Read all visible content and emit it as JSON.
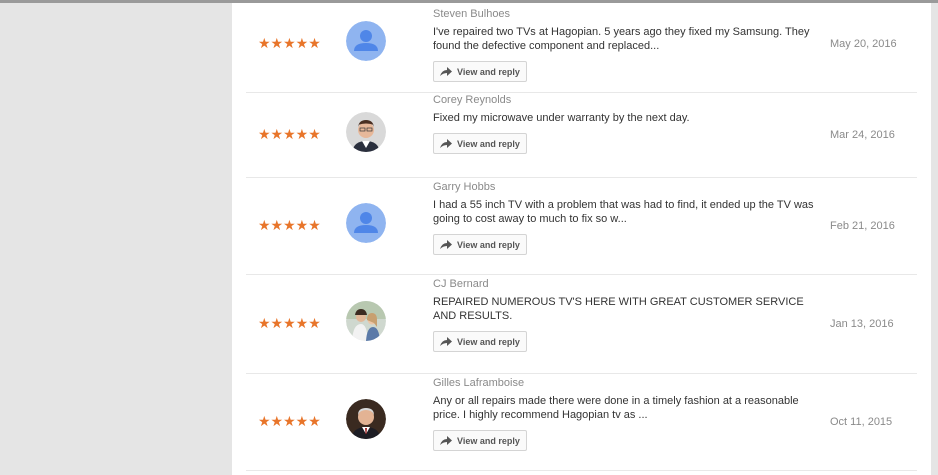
{
  "colors": {
    "star": "#e8752a",
    "default_avatar_bg": "#8fb4f0",
    "default_avatar_fg": "#4f86e8"
  },
  "reviews": [
    {
      "stars": "★★★★★",
      "avatar": "default-avatar-icon",
      "author": "Steven Bulhoes",
      "text": "I've repaired two TVs at Hagopian. 5 years ago they fixed my Samsung. They found the defective component and replaced...",
      "button": "View and reply",
      "date": "May 20, 2016"
    },
    {
      "stars": "★★★★★",
      "avatar": "profile-photo",
      "author": "Corey Reynolds",
      "text": "Fixed my microwave under warranty by the next day.",
      "button": "View and reply",
      "date": "Mar 24, 2016"
    },
    {
      "stars": "★★★★★",
      "avatar": "default-avatar-icon",
      "author": "Garry Hobbs",
      "text": "I had a 55 inch TV with a problem that was had to find, it ended up the TV was going to cost away to much to fix so w...",
      "button": "View and reply",
      "date": "Feb 21, 2016"
    },
    {
      "stars": "★★★★★",
      "avatar": "profile-photo",
      "author": "CJ Bernard",
      "text": "REPAIRED NUMEROUS TV'S HERE WITH GREAT CUSTOMER SERVICE AND RESULTS.",
      "button": "View and reply",
      "date": "Jan 13, 2016"
    },
    {
      "stars": "★★★★★",
      "avatar": "profile-photo",
      "author": "Gilles Laframboise",
      "text": "Any or all repairs made there were done in a timely fashion at a reasonable price. I highly recommend Hagopian tv as ...",
      "button": "View and reply",
      "date": "Oct 11, 2015"
    }
  ]
}
